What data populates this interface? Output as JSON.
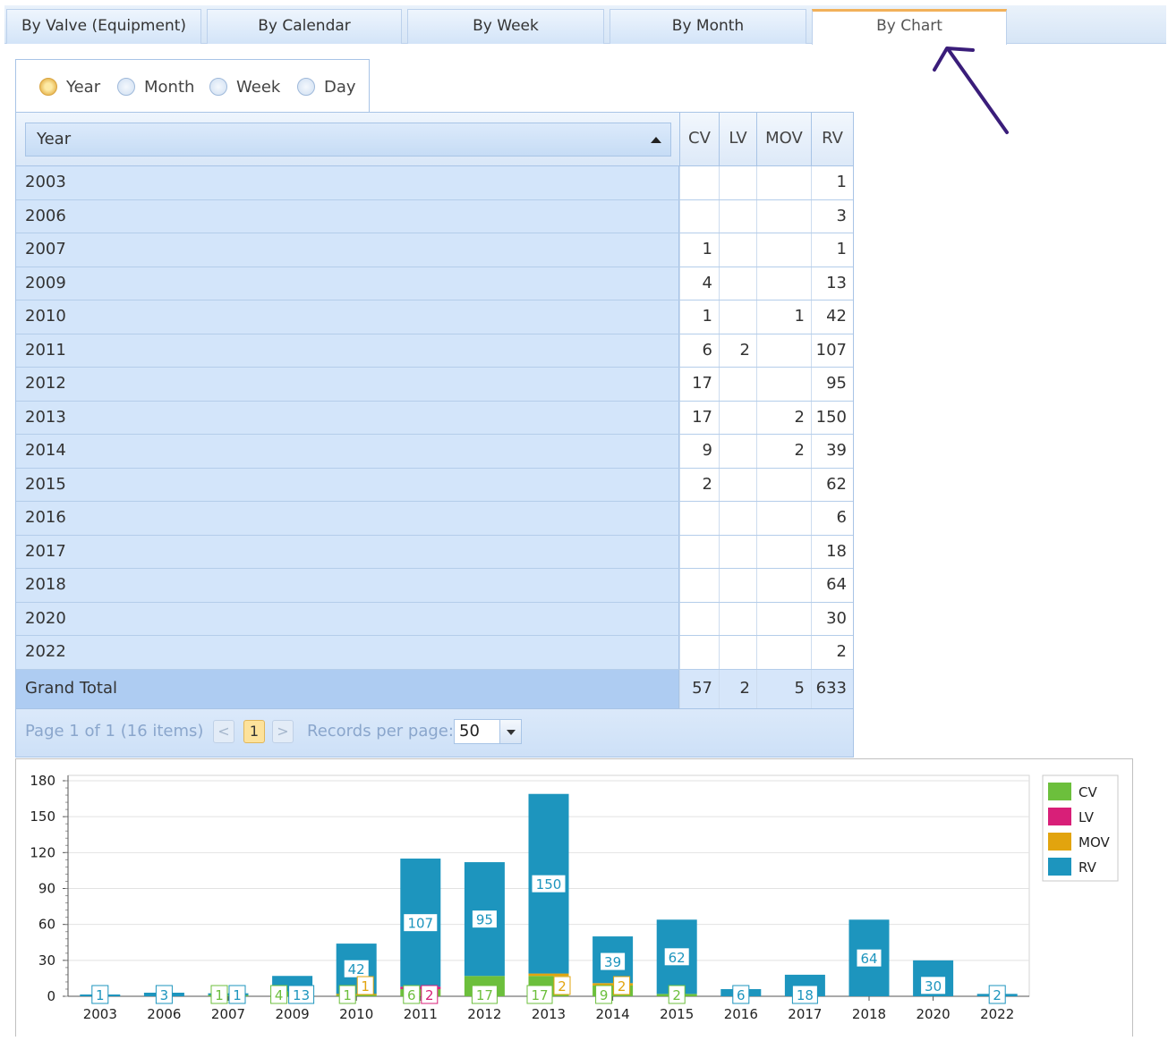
{
  "tabs": [
    {
      "label": "By Valve (Equipment)"
    },
    {
      "label": "By Calendar"
    },
    {
      "label": "By Week"
    },
    {
      "label": "By Month"
    },
    {
      "label": "By Chart"
    }
  ],
  "radios": [
    {
      "label": "Year",
      "checked": true
    },
    {
      "label": "Month",
      "checked": false
    },
    {
      "label": "Week",
      "checked": false
    },
    {
      "label": "Day",
      "checked": false
    }
  ],
  "grid": {
    "row_field": "Year",
    "columns": [
      "CV",
      "LV",
      "MOV",
      "RV"
    ],
    "rows": [
      {
        "year": "2003",
        "cv": "",
        "lv": "",
        "mov": "",
        "rv": "1"
      },
      {
        "year": "2006",
        "cv": "",
        "lv": "",
        "mov": "",
        "rv": "3"
      },
      {
        "year": "2007",
        "cv": "1",
        "lv": "",
        "mov": "",
        "rv": "1"
      },
      {
        "year": "2009",
        "cv": "4",
        "lv": "",
        "mov": "",
        "rv": "13"
      },
      {
        "year": "2010",
        "cv": "1",
        "lv": "",
        "mov": "1",
        "rv": "42"
      },
      {
        "year": "2011",
        "cv": "6",
        "lv": "2",
        "mov": "",
        "rv": "107"
      },
      {
        "year": "2012",
        "cv": "17",
        "lv": "",
        "mov": "",
        "rv": "95"
      },
      {
        "year": "2013",
        "cv": "17",
        "lv": "",
        "mov": "2",
        "rv": "150"
      },
      {
        "year": "2014",
        "cv": "9",
        "lv": "",
        "mov": "2",
        "rv": "39"
      },
      {
        "year": "2015",
        "cv": "2",
        "lv": "",
        "mov": "",
        "rv": "62"
      },
      {
        "year": "2016",
        "cv": "",
        "lv": "",
        "mov": "",
        "rv": "6"
      },
      {
        "year": "2017",
        "cv": "",
        "lv": "",
        "mov": "",
        "rv": "18"
      },
      {
        "year": "2018",
        "cv": "",
        "lv": "",
        "mov": "",
        "rv": "64"
      },
      {
        "year": "2020",
        "cv": "",
        "lv": "",
        "mov": "",
        "rv": "30"
      },
      {
        "year": "2022",
        "cv": "",
        "lv": "",
        "mov": "",
        "rv": "2"
      }
    ],
    "total": {
      "label": "Grand Total",
      "cv": "57",
      "lv": "2",
      "mov": "5",
      "rv": "633"
    }
  },
  "pager": {
    "summary": "Page 1 of 1 (16 items)",
    "prev": "<",
    "current": "1",
    "next": ">",
    "records_label": "Records per page:",
    "records_value": "50"
  },
  "colors": {
    "CV": "#6cbf3c",
    "LV": "#d81f78",
    "MOV": "#e2a40e",
    "RV": "#1d95be"
  },
  "chart_data": {
    "type": "bar",
    "stacked": true,
    "categories": [
      "2003",
      "2006",
      "2007",
      "2009",
      "2010",
      "2011",
      "2012",
      "2013",
      "2014",
      "2015",
      "2016",
      "2017",
      "2018",
      "2020",
      "2022"
    ],
    "series": [
      {
        "name": "CV",
        "values": [
          0,
          0,
          1,
          4,
          1,
          6,
          17,
          17,
          9,
          2,
          0,
          0,
          0,
          0,
          0
        ]
      },
      {
        "name": "LV",
        "values": [
          0,
          0,
          0,
          0,
          0,
          2,
          0,
          0,
          0,
          0,
          0,
          0,
          0,
          0,
          0
        ]
      },
      {
        "name": "MOV",
        "values": [
          0,
          0,
          0,
          0,
          1,
          0,
          0,
          2,
          2,
          0,
          0,
          0,
          0,
          0,
          0
        ]
      },
      {
        "name": "RV",
        "values": [
          1,
          3,
          1,
          13,
          42,
          107,
          95,
          150,
          39,
          62,
          6,
          18,
          64,
          30,
          2
        ]
      }
    ],
    "yticks": [
      "0",
      "30",
      "60",
      "90",
      "120",
      "150",
      "180"
    ],
    "ylim": [
      0,
      180
    ],
    "grid": true,
    "legend": "top-right",
    "data_labels": true
  }
}
